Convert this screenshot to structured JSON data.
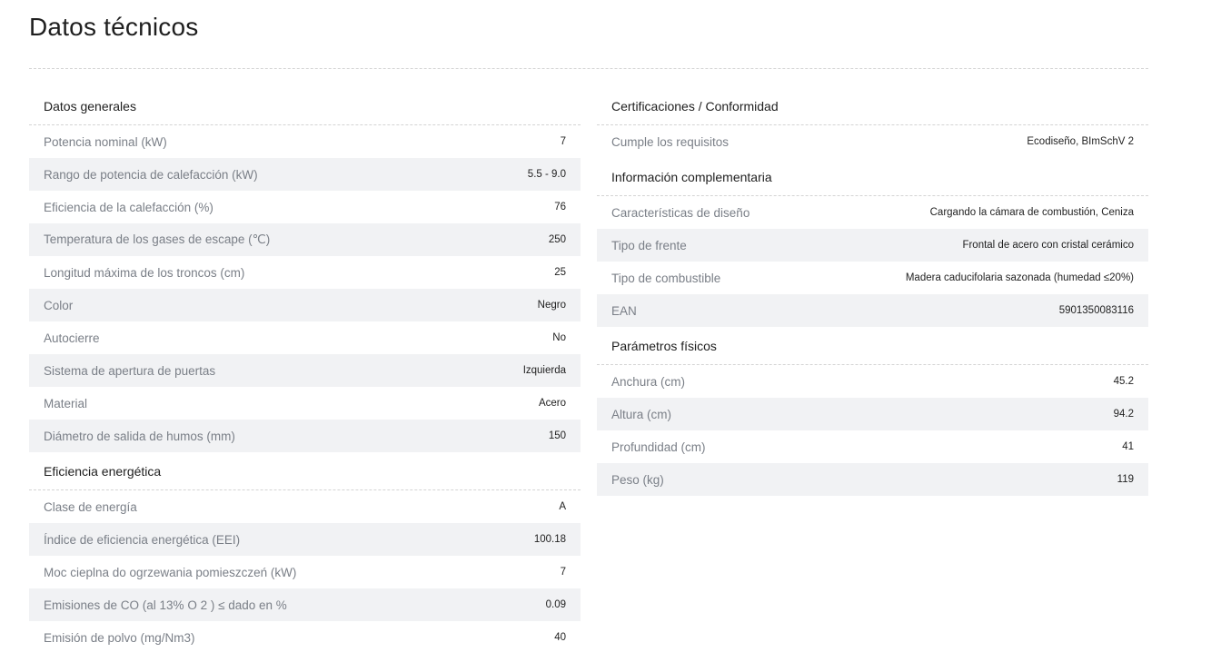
{
  "title": "Datos técnicos",
  "left_sections": [
    {
      "heading": "Datos generales",
      "rows": [
        {
          "label": "Potencia nominal (kW)",
          "value": "7"
        },
        {
          "label": "Rango de potencia de calefacción (kW)",
          "value": "5.5 - 9.0"
        },
        {
          "label": "Eficiencia de la calefacción (%)",
          "value": "76"
        },
        {
          "label": "Temperatura de los gases de escape (℃)",
          "value": "250"
        },
        {
          "label": "Longitud máxima de los troncos (cm)",
          "value": "25"
        },
        {
          "label": "Color",
          "value": "Negro"
        },
        {
          "label": "Autocierre",
          "value": "No"
        },
        {
          "label": "Sistema de apertura de puertas",
          "value": "Izquierda"
        },
        {
          "label": "Material",
          "value": "Acero"
        },
        {
          "label": "Diámetro de salida de humos (mm)",
          "value": "150"
        }
      ]
    },
    {
      "heading": "Eficiencia energética",
      "rows": [
        {
          "label": "Clase de energía",
          "value": "A"
        },
        {
          "label": "Índice de eficiencia energética (EEI)",
          "value": "100.18"
        },
        {
          "label": "Moc cieplna do ogrzewania pomieszczeń (kW)",
          "value": "7"
        },
        {
          "label": "Emisiones de CO (al 13% O 2 ) ≤ dado en %",
          "value": "0.09"
        },
        {
          "label": "Emisión de polvo (mg/Nm3)",
          "value": "40"
        }
      ]
    }
  ],
  "right_sections": [
    {
      "heading": "Certificaciones / Conformidad",
      "rows": [
        {
          "label": "Cumple los requisitos",
          "value": "Ecodiseño, BImSchV 2"
        }
      ]
    },
    {
      "heading": "Información complementaria",
      "rows": [
        {
          "label": "Características de diseño",
          "value": "Cargando la cámara de combustión, Ceniza"
        },
        {
          "label": "Tipo de frente",
          "value": "Frontal de acero con cristal cerámico"
        },
        {
          "label": "Tipo de combustible",
          "value": "Madera caducifolaria sazonada (humedad ≤20%)"
        },
        {
          "label": "EAN",
          "value": "5901350083116"
        }
      ]
    },
    {
      "heading": "Parámetros físicos",
      "rows": [
        {
          "label": "Anchura (cm)",
          "value": "45.2"
        },
        {
          "label": "Altura (cm)",
          "value": "94.2"
        },
        {
          "label": "Profundidad (cm)",
          "value": "41"
        },
        {
          "label": "Peso (kg)",
          "value": "119"
        }
      ]
    }
  ]
}
